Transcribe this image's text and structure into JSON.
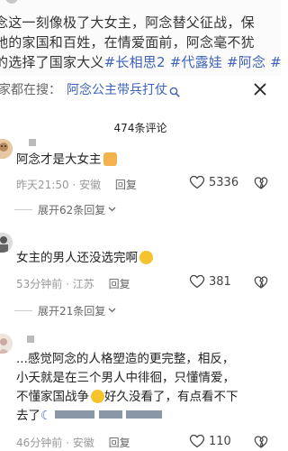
{
  "video_caption": {
    "author": "",
    "line1": "念这一刻像极了大女主，阿念替父征战，保",
    "line2": "她的家国和百姓，在情爱面前，阿念毫不犹",
    "line3_text": "的选择了国家大义",
    "line3_tags": "#长相思2 #代露娃 #阿念 #"
  },
  "search": {
    "prefix": "家都在搜：",
    "query": "阿念公主带兵打仗"
  },
  "comments_header": {
    "count_label": "474条评论"
  },
  "comments": [
    {
      "text": "阿念才是大女主",
      "time": "昨天21:50",
      "location": "安徽",
      "reply_label": "回复",
      "likes": "5336",
      "expand_label": "展开62条回复"
    },
    {
      "text": "女主的男人还没选完啊",
      "time": "53分钟前",
      "location": "江苏",
      "reply_label": "回复",
      "likes": "381",
      "expand_label": "展开21条回复"
    },
    {
      "line1": "...感觉阿念的人格塑造的更完整，相反，",
      "line2": "小夭就是在三个男人中徘徊，只懂情爱，",
      "line3": "不懂家国战争",
      "line3_after": "好久没看了，有点看不下",
      "line4": "去了",
      "time": "46分钟前",
      "location": "安徽",
      "reply_label": "回复",
      "likes": "110"
    }
  ],
  "colors": {
    "link_blue": "#3e63b8",
    "meta_gray": "#999999"
  }
}
